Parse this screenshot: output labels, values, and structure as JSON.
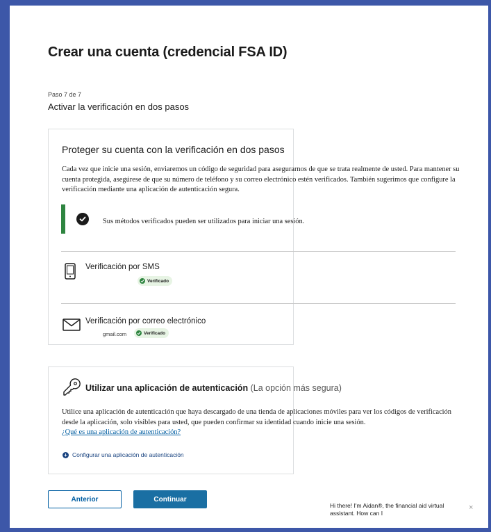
{
  "header": {
    "title": "Crear una cuenta (credencial FSA ID)",
    "step_label": "Paso 7 de 7",
    "step_title": "Activar la verificación en dos pasos"
  },
  "protect": {
    "title": "Proteger su cuenta con la verificación en dos pasos",
    "description": "Cada vez que inicie una sesión, enviaremos un código de seguridad para asegurarnos de que se trata realmente de usted. Para mantener su cuenta protegida, asegúrese de que su número de teléfono y su correo electrónico estén verificados. También sugerimos que configure la verificación mediante una aplicación de autenticación segura.",
    "alert_text": "Sus métodos verificados pueden ser utilizados para iniciar una sesión."
  },
  "methods": {
    "sms": {
      "title": "Verificación por SMS",
      "badge": "Verificado",
      "icon": "phone-icon"
    },
    "email": {
      "title": "Verificación por correo electrónico",
      "value": "gmail.com",
      "badge": "Verificado",
      "icon": "envelope-icon"
    }
  },
  "auth_app": {
    "title": "Utilizar una aplicación de autenticación",
    "subtitle": "(La opción más segura)",
    "description": "Utilice una aplicación de autenticación que haya descargado de una tienda de aplicaciones móviles para ver los códigos de verificación desde la aplicación, solo visibles para usted, que pueden confirmar su identidad cuando inicie una sesión.",
    "link": "¿Qué es una aplicación de autenticación?",
    "setup_label": "Configurar una aplicación de autenticación",
    "icon": "key-icon"
  },
  "buttons": {
    "back": "Anterior",
    "next": "Continuar"
  },
  "chat": {
    "message": "Hi there! I'm Aidan®, the financial aid virtual assistant. How can I",
    "close": "×"
  },
  "colors": {
    "frame": "#3d57a8",
    "success": "#2e8540",
    "primary": "#1a6fa3",
    "link": "#005ea2"
  }
}
